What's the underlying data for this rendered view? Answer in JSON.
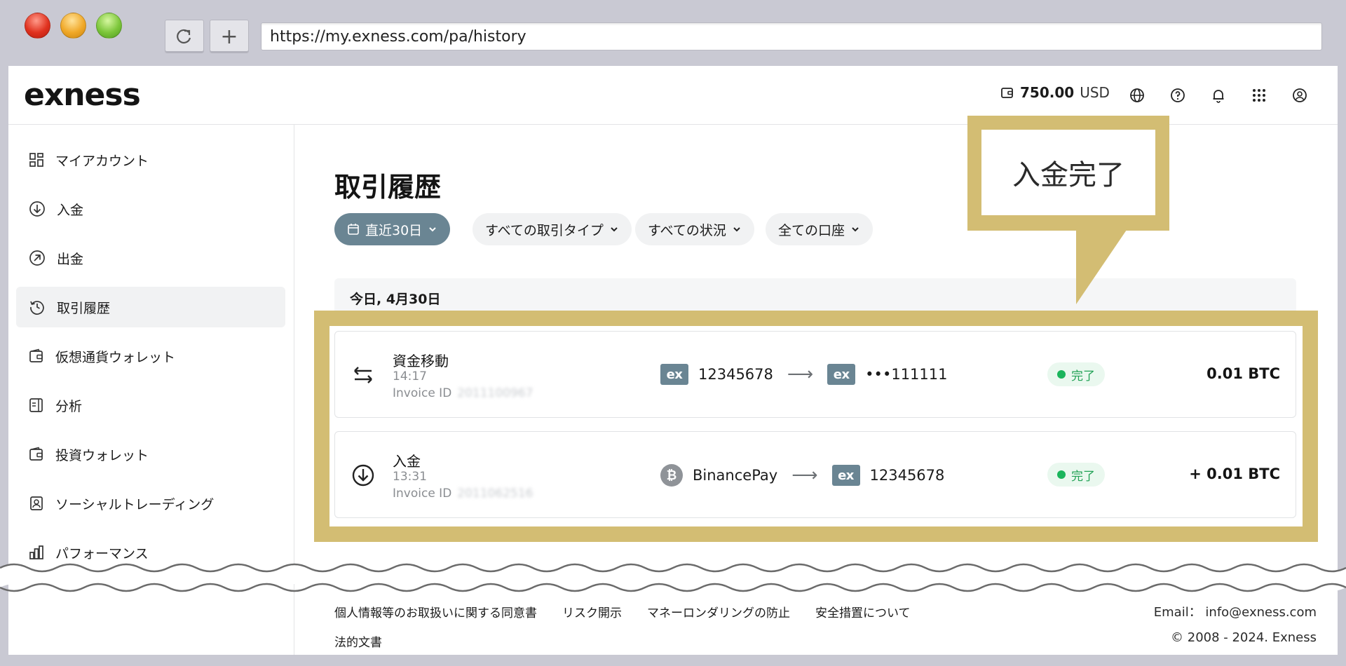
{
  "browser": {
    "url": "https://my.exness.com/pa/history",
    "reload_icon": "reload-icon",
    "newtab_label": "+"
  },
  "header": {
    "logo": "exness",
    "balance_amount": "750.00",
    "balance_currency": "USD"
  },
  "sidebar": {
    "items": [
      {
        "label": "マイアカウント",
        "icon": "dashboard-icon"
      },
      {
        "label": "入金",
        "icon": "deposit-icon"
      },
      {
        "label": "出金",
        "icon": "withdraw-icon"
      },
      {
        "label": "取引履歴",
        "icon": "history-icon"
      },
      {
        "label": "仮想通貨ウォレット",
        "icon": "wallet-icon"
      },
      {
        "label": "分析",
        "icon": "analytics-icon"
      },
      {
        "label": "投資ウォレット",
        "icon": "wallet-icon"
      },
      {
        "label": "ソーシャルトレーディング",
        "icon": "social-trading-icon"
      },
      {
        "label": "パフォーマンス",
        "icon": "performance-icon"
      }
    ]
  },
  "main": {
    "title": "取引履歴",
    "filters": [
      {
        "label": "直近30日"
      },
      {
        "label": "すべての取引タイプ"
      },
      {
        "label": "すべての状況"
      },
      {
        "label": "全ての口座"
      }
    ],
    "day_header": "今日, 4月30日",
    "transactions": [
      {
        "type": "資金移動",
        "time": "14:17",
        "invoice_label": "Invoice ID",
        "invoice_id": "2011100967",
        "from_badge": "ex",
        "from": "12345678",
        "to_badge": "ex",
        "to": "•••111111",
        "status": "完了",
        "amount": "0.01 BTC"
      },
      {
        "type": "入金",
        "time": "13:31",
        "invoice_label": "Invoice ID",
        "invoice_id": "2011062516",
        "from_badge": "₿",
        "from": "BinancePay",
        "to_badge": "ex",
        "to": "12345678",
        "status": "完了",
        "amount": "+ 0.01 BTC"
      }
    ]
  },
  "footer": {
    "links": [
      "個人情報等のお取扱いに関する同意書",
      "リスク開示",
      "マネーロンダリングの防止",
      "安全措置について"
    ],
    "legal": "法的文書",
    "email": "Email： info@exness.com",
    "copyright": "© 2008 - 2024. Exness"
  },
  "callout": {
    "text": "入金完了"
  },
  "colors": {
    "accent": "#d3bd73",
    "chip_active": "#6a8593",
    "status_green": "#21a155"
  }
}
